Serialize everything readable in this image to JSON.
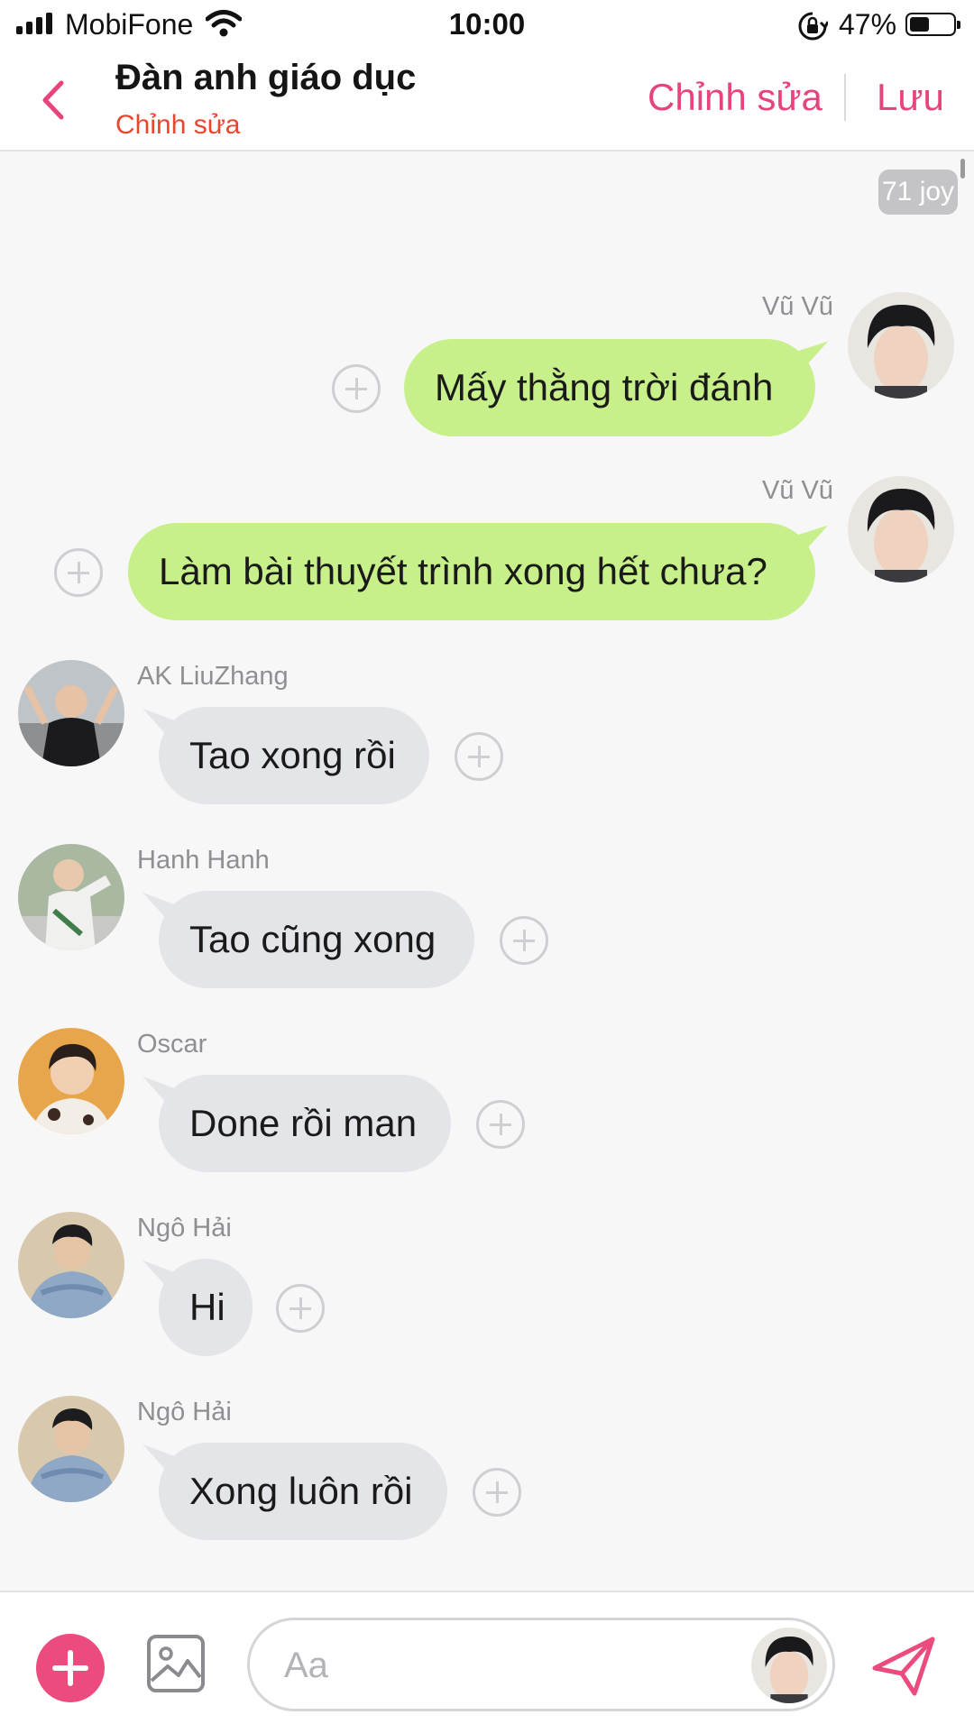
{
  "status_bar": {
    "carrier": "MobiFone",
    "time": "10:00",
    "battery": "47%"
  },
  "header": {
    "title": "Đàn anh giáo dục",
    "subtitle": "Chỉnh sửa",
    "edit_label": "Chỉnh sửa",
    "save_label": "Lưu"
  },
  "chat": {
    "count_badge": "71 joy",
    "messages": [
      {
        "sender": "Vũ Vũ",
        "text": "Mấy thằng trời đánh",
        "direction": "outgoing"
      },
      {
        "sender": "Vũ Vũ",
        "text": "Làm bài thuyết trình xong hết chưa?",
        "direction": "outgoing"
      },
      {
        "sender": "AK LiuZhang",
        "text": "Tao xong rồi",
        "direction": "incoming"
      },
      {
        "sender": "Hanh Hanh",
        "text": "Tao cũng xong",
        "direction": "incoming"
      },
      {
        "sender": "Oscar",
        "text": "Done rồi man",
        "direction": "incoming"
      },
      {
        "sender": "Ngô Hải",
        "text": "Hi",
        "direction": "incoming"
      },
      {
        "sender": "Ngô Hải",
        "text": "Xong luôn rồi",
        "direction": "incoming"
      }
    ]
  },
  "input_bar": {
    "placeholder": "Aa"
  },
  "colors": {
    "accent": "#e6447b",
    "subtitle": "#e8462e",
    "outgoing_bubble": "#c7ef8a",
    "incoming_bubble": "#e4e5e9"
  }
}
